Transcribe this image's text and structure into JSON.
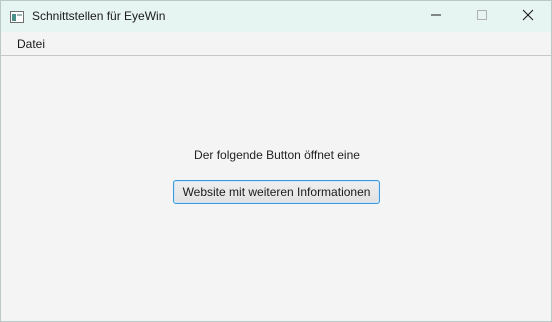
{
  "window": {
    "title": "Schnittstellen für EyeWin"
  },
  "menubar": {
    "items": [
      {
        "label": "Datei"
      }
    ]
  },
  "main": {
    "label": "Der folgende Button öffnet eine",
    "button_label": "Website mit weiteren Informationen"
  },
  "icons": {
    "app": "app-window-icon",
    "minimize": "minimize-icon",
    "maximize": "maximize-icon",
    "close": "close-icon"
  },
  "colors": {
    "titlebar_bg": "#e6f5f2",
    "content_bg": "#f4f4f4",
    "button_focus_border": "#3a9ad9"
  }
}
